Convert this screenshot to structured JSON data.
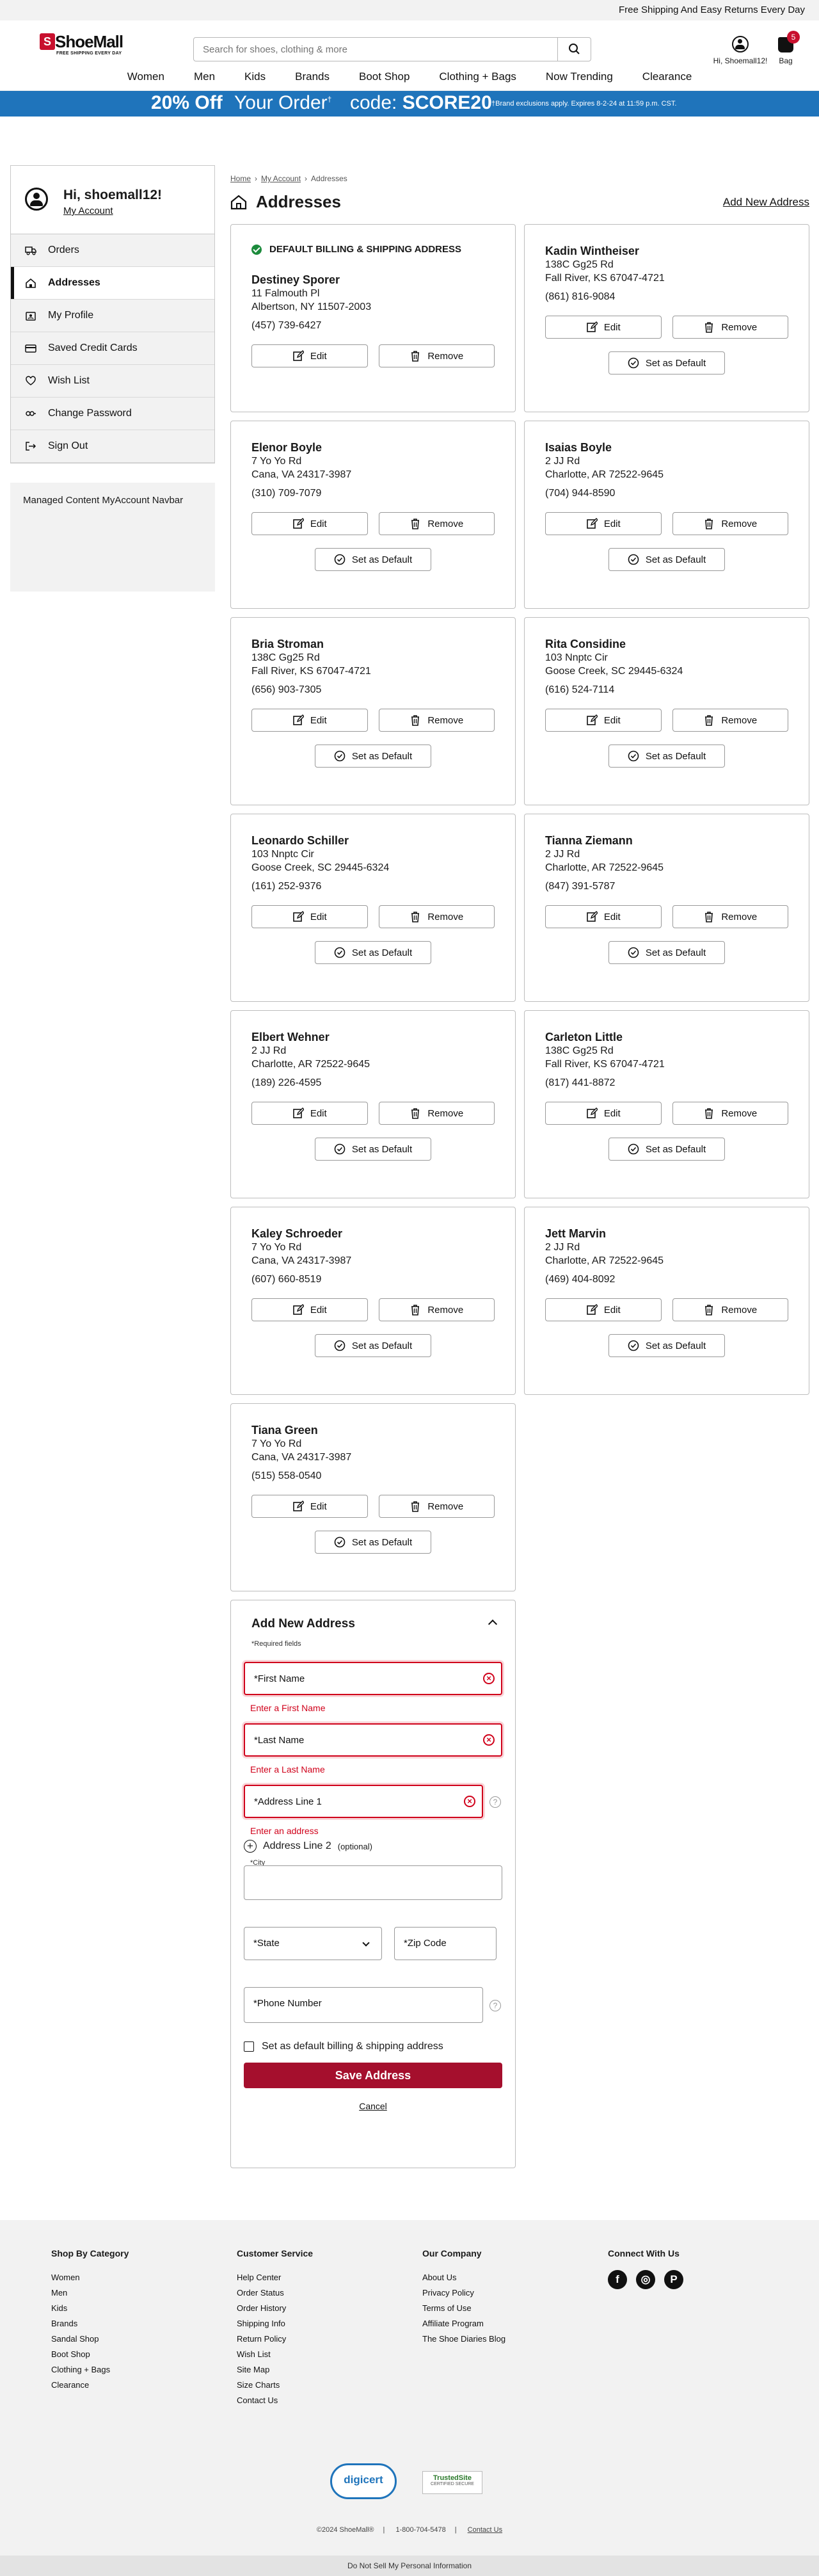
{
  "topbar": {
    "text": "Free Shipping And Easy Returns Every Day"
  },
  "header": {
    "logo": "ShoeMall",
    "logo_mark": "S",
    "logo_tagline": "FREE SHIPPING EVERY DAY",
    "search_placeholder": "Search for shoes, clothing & more",
    "account_label": "Hi, Shoemall12!",
    "bag_label": "Bag",
    "bag_count": "5"
  },
  "nav": [
    "Women",
    "Men",
    "Kids",
    "Brands",
    "Boot Shop",
    "Clothing + Bags",
    "Now Trending",
    "Clearance"
  ],
  "promo": {
    "headline": "20% Off",
    "sub": "Your Order",
    "sup": "†",
    "code_prefix": "code:",
    "code": "SCORE20",
    "terms": "†Brand exclusions apply. Expires 8-2-24 at 11:59 p.m. CST."
  },
  "sidebar": {
    "greeting": "Hi, shoemall12!",
    "account_link": "My Account",
    "items": [
      {
        "label": "Orders",
        "icon": "truck-icon"
      },
      {
        "label": "Addresses",
        "icon": "home-icon"
      },
      {
        "label": "My Profile",
        "icon": "profile-icon"
      },
      {
        "label": "Saved Credit Cards",
        "icon": "credit-card-icon"
      },
      {
        "label": "Wish List",
        "icon": "heart-icon"
      },
      {
        "label": "Change Password",
        "icon": "key-icon"
      },
      {
        "label": "Sign Out",
        "icon": "sign-out-icon"
      }
    ],
    "managed": "Managed Content MyAccount Navbar"
  },
  "breadcrumb": {
    "home": "Home",
    "account": "My Account",
    "current": "Addresses"
  },
  "page": {
    "title": "Addresses",
    "add_link": "Add New Address"
  },
  "default_label": "DEFAULT BILLING & SHIPPING ADDRESS",
  "buttons": {
    "edit": "Edit",
    "remove": "Remove",
    "set_default": "Set as Default"
  },
  "addresses": [
    {
      "name": "Destiney Sporer",
      "line1": "11 Falmouth Pl",
      "line2": "Albertson, NY 11507-2003",
      "phone": "(457) 739-6427",
      "default": true
    },
    {
      "name": "Kadin Wintheiser",
      "line1": "138C Gg25 Rd",
      "line2": "Fall River, KS 67047-4721",
      "phone": "(861) 816-9084"
    },
    {
      "name": "Elenor Boyle",
      "line1": "7 Yo Yo Rd",
      "line2": "Cana, VA 24317-3987",
      "phone": "(310) 709-7079"
    },
    {
      "name": "Isaias Boyle",
      "line1": "2 JJ Rd",
      "line2": "Charlotte, AR 72522-9645",
      "phone": "(704) 944-8590"
    },
    {
      "name": "Bria Stroman",
      "line1": "138C Gg25 Rd",
      "line2": "Fall River, KS 67047-4721",
      "phone": "(656) 903-7305"
    },
    {
      "name": "Rita Considine",
      "line1": "103 Nnptc Cir",
      "line2": "Goose Creek, SC 29445-6324",
      "phone": "(616) 524-7114"
    },
    {
      "name": "Leonardo Schiller",
      "line1": "103 Nnptc Cir",
      "line2": "Goose Creek, SC 29445-6324",
      "phone": "(161) 252-9376"
    },
    {
      "name": "Tianna Ziemann",
      "line1": "2 JJ Rd",
      "line2": "Charlotte, AR 72522-9645",
      "phone": "(847) 391-5787"
    },
    {
      "name": "Elbert Wehner",
      "line1": "2 JJ Rd",
      "line2": "Charlotte, AR 72522-9645",
      "phone": "(189) 226-4595"
    },
    {
      "name": "Carleton Little",
      "line1": "138C Gg25 Rd",
      "line2": "Fall River, KS 67047-4721",
      "phone": "(817) 441-8872"
    },
    {
      "name": "Kaley Schroeder",
      "line1": "7 Yo Yo Rd",
      "line2": "Cana, VA 24317-3987",
      "phone": "(607) 660-8519"
    },
    {
      "name": "Jett Marvin",
      "line1": "2 JJ Rd",
      "line2": "Charlotte, AR 72522-9645",
      "phone": "(469) 404-8092"
    },
    {
      "name": "Tiana Green",
      "line1": "7 Yo Yo Rd",
      "line2": "Cana, VA 24317-3987",
      "phone": "(515) 558-0540"
    }
  ],
  "form": {
    "title": "Add New Address",
    "required": "*Required fields",
    "first_name": "*First Name",
    "first_name_err": "Enter a First Name",
    "last_name": "*Last Name",
    "last_name_err": "Enter a Last Name",
    "address1": "*Address Line 1",
    "address1_err": "Enter an address",
    "address2": "Address Line 2",
    "optional": "(optional)",
    "city": "*City",
    "state": "*State",
    "zip": "*Zip Code",
    "phone": "*Phone Number",
    "default_cb": "Set as default billing & shipping address",
    "save": "Save Address",
    "cancel": "Cancel"
  },
  "footer": {
    "cols": [
      {
        "title": "Shop By Category",
        "links": [
          "Women",
          "Men",
          "Kids",
          "Brands",
          "Sandal Shop",
          "Boot Shop",
          "Clothing + Bags",
          "Clearance"
        ]
      },
      {
        "title": "Customer Service",
        "links": [
          "Help Center",
          "Order Status",
          "Order History",
          "Shipping Info",
          "Return Policy",
          "Wish List",
          "Site Map",
          "Size Charts",
          "Contact Us"
        ]
      },
      {
        "title": "Our Company",
        "links": [
          "About Us",
          "Privacy Policy",
          "Terms of Use",
          "Affiliate Program",
          "The Shoe Diaries Blog"
        ]
      }
    ],
    "connect": "Connect With Us",
    "copyright": "©2024 ShoeMall®",
    "phone": "1-800-704-5478",
    "contact": "Contact Us",
    "dnsp": "Do Not Sell My Personal Information",
    "digicert": "digicert",
    "trusted": "TrustedSite",
    "trusted_sub": "CERTIFIED SECURE"
  }
}
